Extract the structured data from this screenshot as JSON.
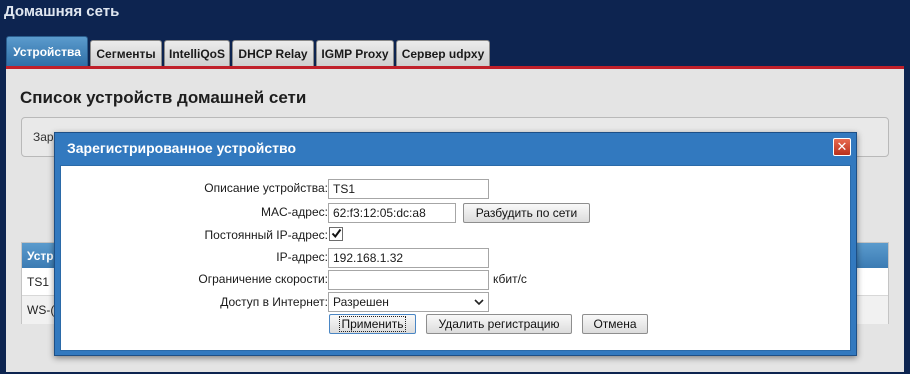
{
  "app": {
    "title": "Домашняя сеть"
  },
  "tabs": [
    {
      "label": "Устройства",
      "active": true
    },
    {
      "label": "Сегменты"
    },
    {
      "label": "IntelliQoS"
    },
    {
      "label": "DHCP Relay"
    },
    {
      "label": "IGMP Proxy"
    },
    {
      "label": "Сервер udpxy"
    }
  ],
  "page": {
    "section_title": "Список устройств домашней сети",
    "filter_label": "Зар",
    "table": {
      "header": "Устр",
      "rows": [
        "TS1",
        "WS-("
      ]
    }
  },
  "dialog": {
    "title": "Зарегистрированное устройство",
    "close_icon": "close-icon",
    "fields": {
      "description_label": "Описание устройства:",
      "description_value": "TS1",
      "mac_label": "MAC-адрес:",
      "mac_value": "62:f3:12:05:dc:a8",
      "wake_button": "Разбудить по сети",
      "static_ip_label": "Постоянный IP-адрес:",
      "static_ip_checked": true,
      "ip_label": "IP-адрес:",
      "ip_value": "192.168.1.32",
      "speed_label": "Ограничение скорости:",
      "speed_value": "",
      "speed_unit": "кбит/с",
      "access_label": "Доступ в Интернет:",
      "access_value": "Разрешен"
    },
    "buttons": {
      "apply": "Применить",
      "unregister": "Удалить регистрацию",
      "cancel": "Отмена"
    }
  },
  "colors": {
    "background": "#0d2450",
    "accent_blue": "#3279bf",
    "tab_underline": "#c0202a",
    "close_red": "#d24a33"
  }
}
